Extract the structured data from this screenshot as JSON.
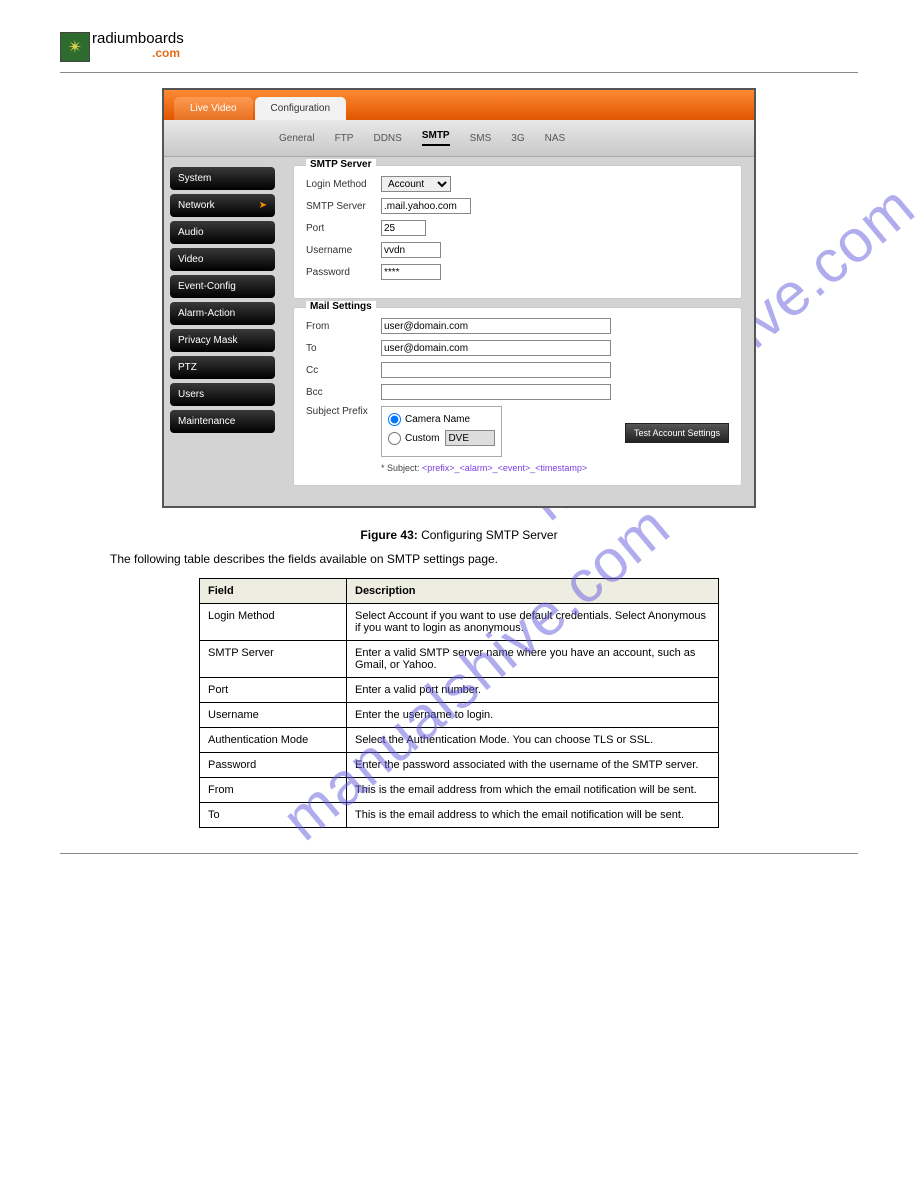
{
  "brand": {
    "black": "radiumboards",
    "orange": ".com"
  },
  "top_tabs": {
    "live": "Live Video",
    "config": "Configuration"
  },
  "sub_tabs": [
    "General",
    "FTP",
    "DDNS",
    "SMTP",
    "SMS",
    "3G",
    "NAS"
  ],
  "sidebar": [
    "System",
    "Network",
    "Audio",
    "Video",
    "Event-Config",
    "Alarm-Action",
    "Privacy Mask",
    "PTZ",
    "Users",
    "Maintenance"
  ],
  "smtp": {
    "title": "SMTP Server",
    "login_label": "Login Method",
    "login_value": "Account",
    "server_label": "SMTP Server",
    "server_value": ".mail.yahoo.com",
    "port_label": "Port",
    "port_value": "25",
    "user_label": "Username",
    "user_value": "vvdn",
    "pass_label": "Password",
    "pass_value": "****"
  },
  "mail": {
    "title": "Mail Settings",
    "from_l": "From",
    "from_v": "user@domain.com",
    "to_l": "To",
    "to_v": "user@domain.com",
    "cc_l": "Cc",
    "cc_v": "",
    "bcc_l": "Bcc",
    "bcc_v": "",
    "subj_l": "Subject Prefix",
    "opt1": "Camera Name",
    "opt2": "Custom",
    "custom_v": "DVE",
    "test": "Test Account Settings",
    "note_pre": "* Subject: ",
    "note_seq": "<prefix>_<alarm>_<event>_<timestamp>"
  },
  "figure": {
    "label": "Figure 43: ",
    "text": "Configuring SMTP Server"
  },
  "intro": "The following table describes the fields available on SMTP settings page.",
  "table": {
    "h1": "Field",
    "h2": "Description",
    "rows": [
      {
        "f": "Login Method",
        "d": "Select Account if you want to use default credentials. Select Anonymous if you want to login as anonymous."
      },
      {
        "f": "SMTP Server",
        "d": "Enter a valid SMTP server name where you have an account, such as Gmail, or Yahoo."
      },
      {
        "f": "Port",
        "d": "Enter a valid port number."
      },
      {
        "f": "Username",
        "d": "Enter the username to login."
      },
      {
        "f": "Authentication Mode",
        "d": "Select the Authentication Mode. You can choose TLS or SSL."
      },
      {
        "f": "Password",
        "d": "Enter the password associated with the username of the SMTP server."
      },
      {
        "f": "From",
        "d": "This is the email address from which the email notification will be sent."
      },
      {
        "f": "To",
        "d": "This is the email address to which the email notification will be sent."
      }
    ]
  },
  "wm": "manualshive.com"
}
